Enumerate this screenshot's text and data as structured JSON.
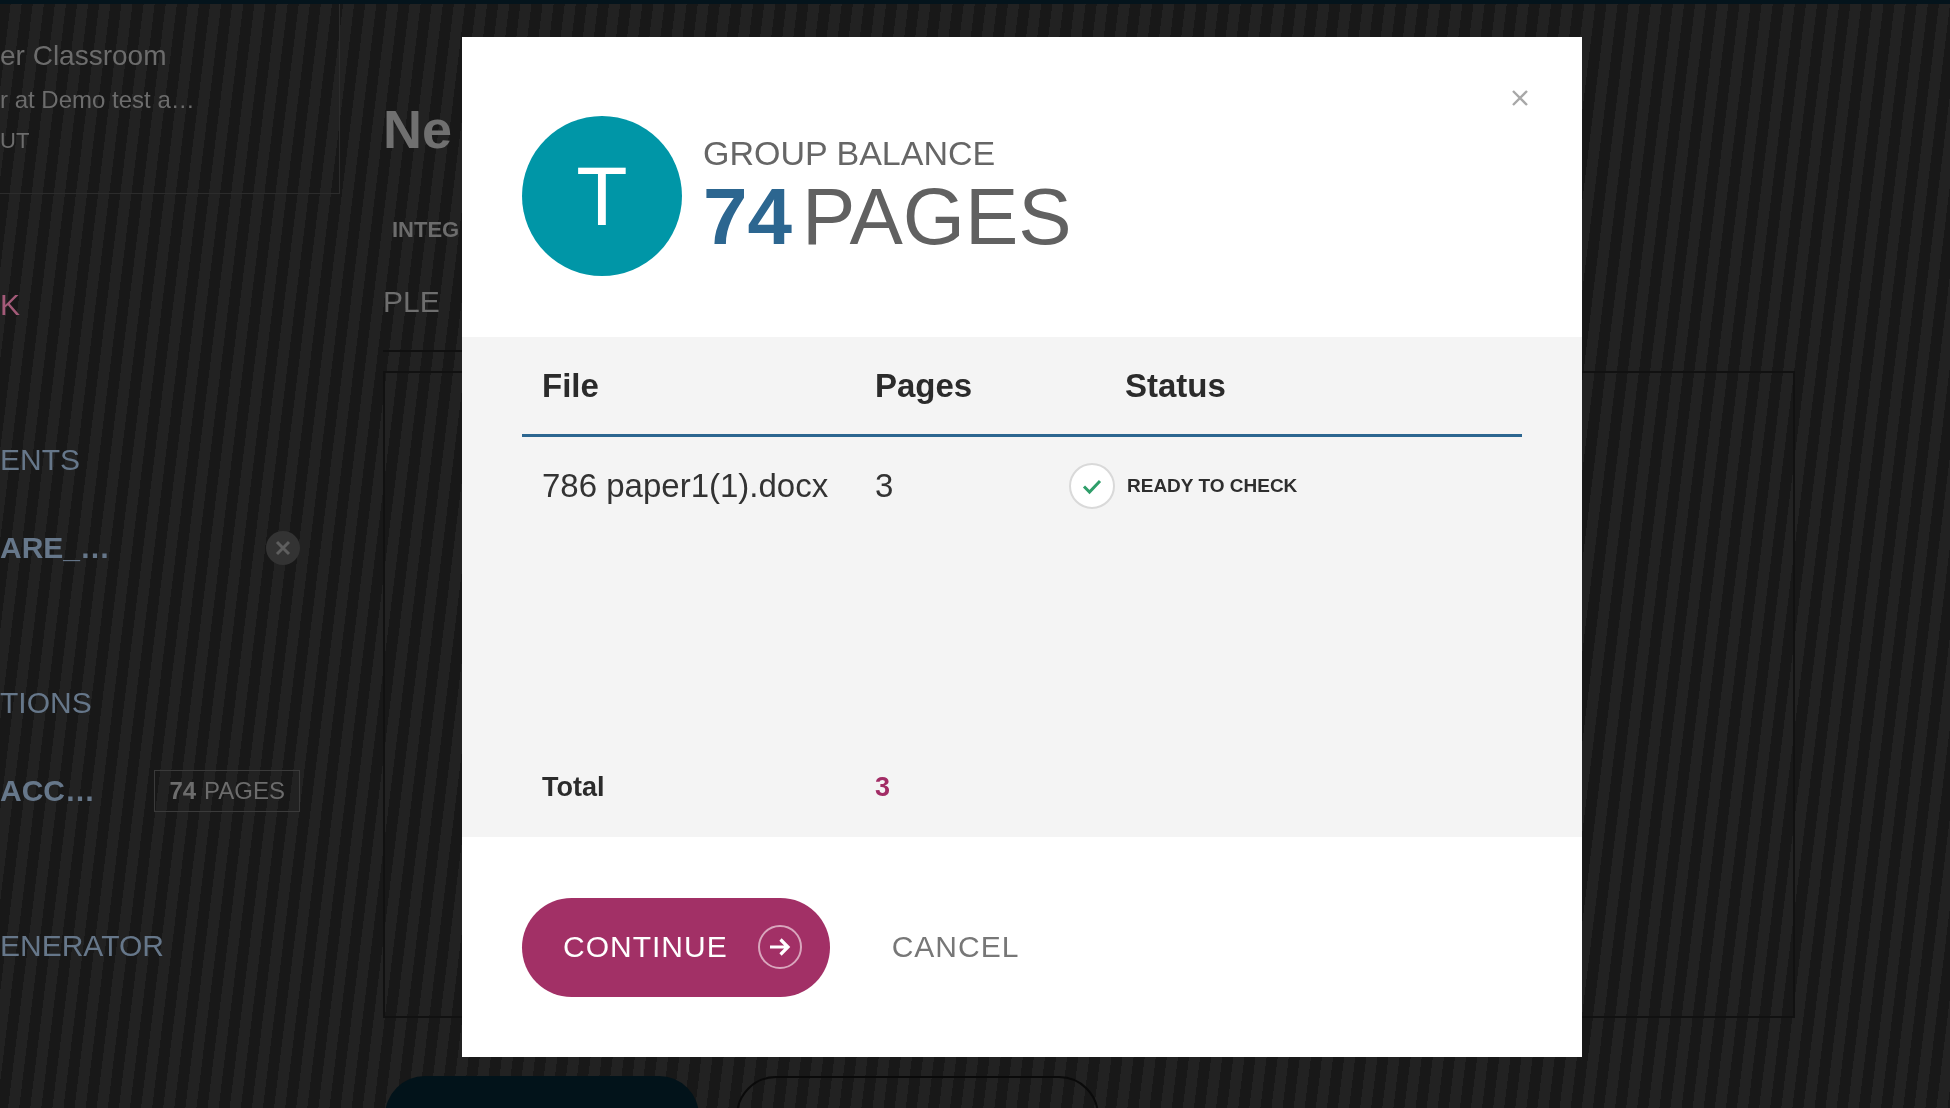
{
  "background_page": {
    "sidebar": {
      "profile": {
        "name": "er Classroom",
        "subtitle": "r at Demo test a…",
        "link": "UT"
      },
      "items": [
        {
          "label": "K",
          "kind": "link",
          "removable": false
        },
        {
          "label": "ENTS",
          "kind": "nav",
          "removable": false
        },
        {
          "label": "ARE_…",
          "kind": "sub",
          "removable": true
        },
        {
          "label": "TIONS",
          "kind": "nav",
          "removable": false
        },
        {
          "label": "ACC…",
          "kind": "sub",
          "removable": false,
          "badge": {
            "count": "74",
            "unit": "PAGES"
          }
        },
        {
          "label": "ENERATOR",
          "kind": "nav",
          "removable": false
        }
      ]
    },
    "main": {
      "heading": "Ne",
      "section_label": "INTEG",
      "field": {
        "placeholder": "PLE"
      },
      "buttons": [
        {
          "kind": "filled"
        },
        {
          "kind": "outlined"
        }
      ]
    }
  },
  "modal": {
    "avatar": {
      "initial": "T"
    },
    "balance": {
      "label": "GROUP BALANCE",
      "count": "74",
      "unit": "PAGES"
    },
    "table": {
      "columns": [
        "File",
        "Pages",
        "Status"
      ],
      "rows": [
        {
          "file": "786 paper1(1).docx",
          "pages": "3",
          "status": "READY TO CHECK",
          "ready": true
        }
      ],
      "total": {
        "label": "Total",
        "pages": "3"
      }
    },
    "buttons": [
      {
        "label": "CONTINUE",
        "kind": "primary"
      },
      {
        "label": "CANCEL",
        "kind": "secondary"
      }
    ]
  }
}
